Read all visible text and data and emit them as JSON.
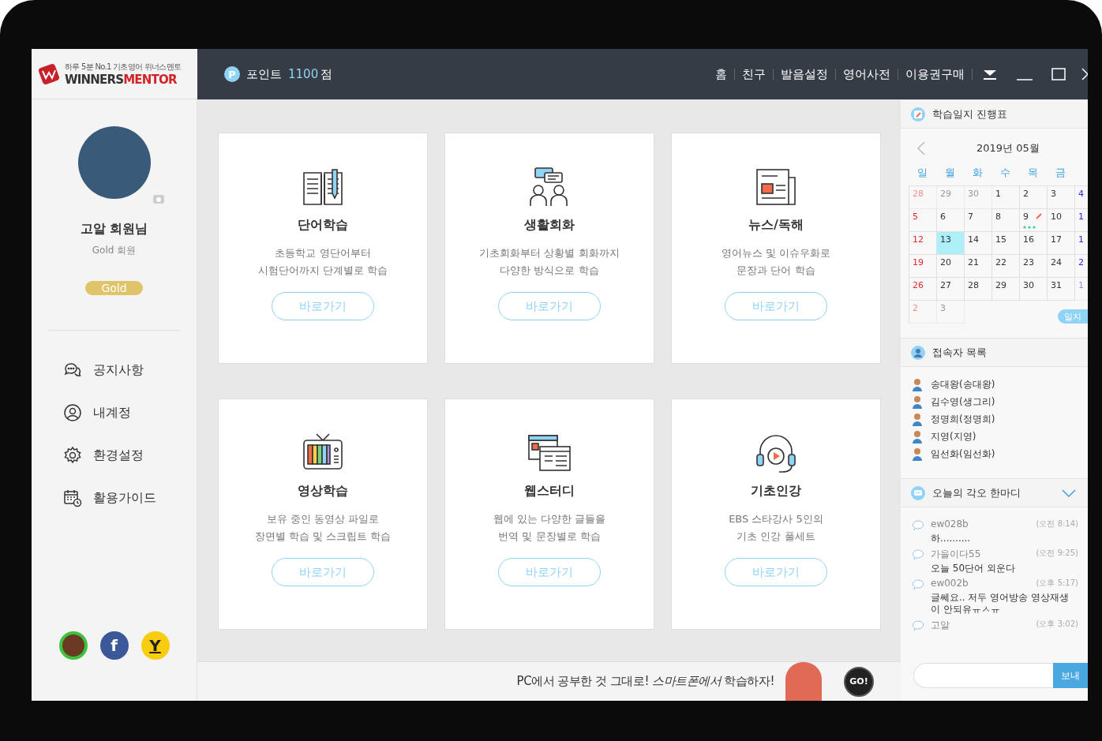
{
  "logo": {
    "tagline": "하루 5분 No.1 기초영어 위너스멘토",
    "name_main": "WINNERS",
    "name_accent": "MENTOR"
  },
  "points": {
    "icon_letter": "P",
    "label": "포인트",
    "value": "1100",
    "unit": "점"
  },
  "top_nav": [
    "홈",
    "친구",
    "발음설정",
    "영어사전",
    "이용권구매"
  ],
  "profile": {
    "name": "고알 회원님",
    "grade": "Gold 회원",
    "badge": "Gold"
  },
  "sidebar": {
    "items": [
      {
        "kind": "chat",
        "label": "공지사항"
      },
      {
        "kind": "user",
        "label": "내계정"
      },
      {
        "kind": "gear",
        "label": "환경설정"
      },
      {
        "kind": "calendar",
        "label": "활용가이드"
      }
    ],
    "social": [
      {
        "kind": "green"
      },
      {
        "kind": "facebook",
        "label": "f"
      },
      {
        "kind": "yellow",
        "label": "Y"
      }
    ]
  },
  "cards": [
    {
      "kind": "book",
      "title": "단어학습",
      "lines": [
        "초등학교 영단어부터",
        "시험단어까지 단계별로 학습"
      ],
      "button": "바로가기"
    },
    {
      "kind": "people",
      "title": "생활회화",
      "lines": [
        "기초회화부터 상황별 회화까지",
        "다양한 방식으로 학습"
      ],
      "button": "바로가기"
    },
    {
      "kind": "news",
      "title": "뉴스/독해",
      "lines": [
        "영어뉴스 및 이슈우화로",
        "문장과 단어 학습"
      ],
      "button": "바로가기"
    },
    {
      "kind": "tv",
      "title": "영상학습",
      "lines": [
        "보유 중인 동영상 파일로",
        "장면별 학습 및 스크립트 학습"
      ],
      "button": "바로가기"
    },
    {
      "kind": "web",
      "title": "웹스터디",
      "lines": [
        "웹에 있는 다양한 글들을",
        "번역 및 문장별로 학습"
      ],
      "button": "바로가기"
    },
    {
      "kind": "headset",
      "title": "기초인강",
      "lines": [
        "EBS 스타강사 5인의",
        "기초 인강 풀세트"
      ],
      "button": "바로가기"
    }
  ],
  "banner": {
    "text": "PC에서 공부한 것 그대로! *스마트폰에서* 학습하자!",
    "go": "GO!"
  },
  "calendar": {
    "title": "학습일지 진행표",
    "month": "2019년 05월",
    "weekdays": [
      "일",
      "월",
      "화",
      "수",
      "목",
      "금"
    ],
    "weeks": [
      [
        {
          "day": "28",
          "muted": true,
          "selected": false,
          "entry": false
        },
        {
          "day": "29",
          "muted": true,
          "selected": false,
          "entry": false
        },
        {
          "day": "30",
          "muted": true,
          "selected": false,
          "entry": false
        },
        {
          "day": "1",
          "muted": false,
          "selected": false,
          "entry": false
        },
        {
          "day": "2",
          "muted": false,
          "selected": false,
          "entry": false
        },
        {
          "day": "3",
          "muted": false,
          "selected": false,
          "entry": false
        },
        {
          "day": "4",
          "muted": false,
          "selected": false,
          "entry": false
        }
      ],
      [
        {
          "day": "5",
          "muted": false,
          "selected": false,
          "entry": false
        },
        {
          "day": "6",
          "muted": false,
          "selected": false,
          "entry": false
        },
        {
          "day": "7",
          "muted": false,
          "selected": false,
          "entry": false
        },
        {
          "day": "8",
          "muted": false,
          "selected": false,
          "entry": false
        },
        {
          "day": "9",
          "muted": false,
          "selected": false,
          "entry": true
        },
        {
          "day": "10",
          "muted": false,
          "selected": false,
          "entry": false
        },
        {
          "day": "1",
          "muted": false,
          "selected": false,
          "entry": false
        }
      ],
      [
        {
          "day": "12",
          "muted": false,
          "selected": false,
          "entry": false
        },
        {
          "day": "13",
          "muted": false,
          "selected": true,
          "entry": false
        },
        {
          "day": "14",
          "muted": false,
          "selected": false,
          "entry": false
        },
        {
          "day": "15",
          "muted": false,
          "selected": false,
          "entry": false
        },
        {
          "day": "16",
          "muted": false,
          "selected": false,
          "entry": false
        },
        {
          "day": "17",
          "muted": false,
          "selected": false,
          "entry": false
        },
        {
          "day": "1",
          "muted": false,
          "selected": false,
          "entry": false
        }
      ],
      [
        {
          "day": "19",
          "muted": false,
          "selected": false,
          "entry": false
        },
        {
          "day": "20",
          "muted": false,
          "selected": false,
          "entry": false
        },
        {
          "day": "21",
          "muted": false,
          "selected": false,
          "entry": false
        },
        {
          "day": "22",
          "muted": false,
          "selected": false,
          "entry": false
        },
        {
          "day": "23",
          "muted": false,
          "selected": false,
          "entry": false
        },
        {
          "day": "24",
          "muted": false,
          "selected": false,
          "entry": false
        },
        {
          "day": "2",
          "muted": false,
          "selected": false,
          "entry": false
        }
      ],
      [
        {
          "day": "26",
          "muted": false,
          "selected": false,
          "entry": false
        },
        {
          "day": "27",
          "muted": false,
          "selected": false,
          "entry": false
        },
        {
          "day": "28",
          "muted": false,
          "selected": false,
          "entry": false
        },
        {
          "day": "29",
          "muted": false,
          "selected": false,
          "entry": false
        },
        {
          "day": "30",
          "muted": false,
          "selected": false,
          "entry": false
        },
        {
          "day": "31",
          "muted": false,
          "selected": false,
          "entry": false
        },
        {
          "day": "1",
          "muted": true,
          "selected": false,
          "entry": false
        }
      ],
      [
        {
          "day": "2",
          "muted": true,
          "selected": false,
          "entry": false
        },
        {
          "day": "3",
          "muted": true,
          "selected": false,
          "entry": false
        }
      ]
    ],
    "button": "일지"
  },
  "users": {
    "title": "접속자 목록",
    "items": [
      "송대왕(송대왕)",
      "김수영(생그리)",
      "정명희(정명희)",
      "지영(지영)",
      "임선화(임선화)"
    ]
  },
  "comments": {
    "title": "오늘의 각오 한마디",
    "expanded": true,
    "items": [
      {
        "user": "ew028b",
        "time": "(오전 8:14)",
        "text": "하.........."
      },
      {
        "user": "가을이다55",
        "time": "(오전 9:25)",
        "text": "오늘 50단어 외운다"
      },
      {
        "user": "ew002b",
        "time": "(오후 5:17)",
        "text": "글쎄요.. 저두 영어방송 영상재생이 안되유ㅠㅅㅠ"
      },
      {
        "user": "고알",
        "time": "(오후 3:02)"
      }
    ],
    "send": "보내"
  }
}
